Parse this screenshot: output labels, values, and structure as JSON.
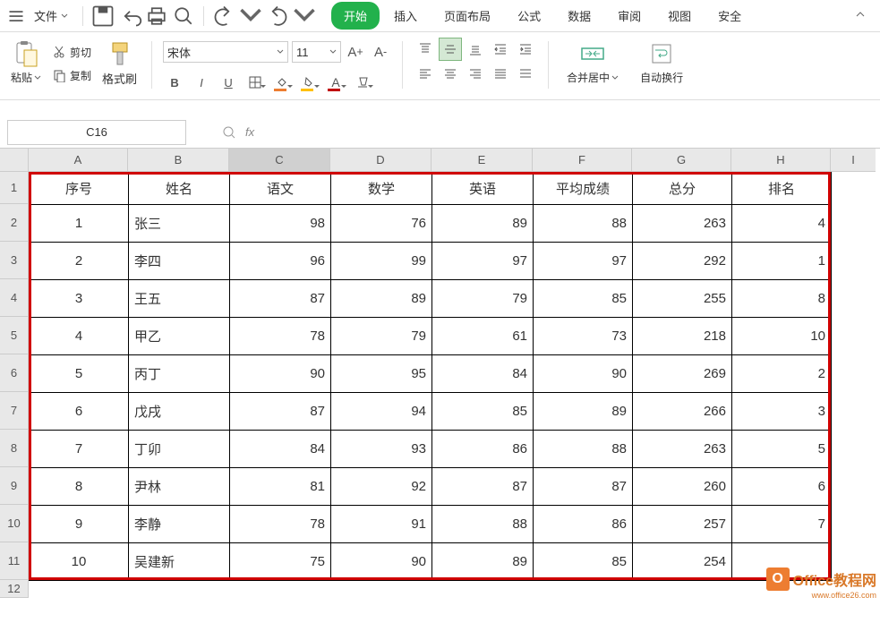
{
  "menu": {
    "file": "文件",
    "tabs": [
      "开始",
      "插入",
      "页面布局",
      "公式",
      "数据",
      "审阅",
      "视图",
      "安全"
    ],
    "active_tab": 0
  },
  "ribbon": {
    "paste": "粘贴",
    "cut": "剪切",
    "copy": "复制",
    "format_painter": "格式刷",
    "font_name": "宋体",
    "font_size": "11",
    "merge_center": "合并居中",
    "wrap_text": "自动换行"
  },
  "formula_bar": {
    "cell_ref": "C16",
    "fx": "fx"
  },
  "columns": [
    "A",
    "B",
    "C",
    "D",
    "E",
    "F",
    "G",
    "H",
    "I"
  ],
  "row_numbers": [
    "1",
    "2",
    "3",
    "4",
    "5",
    "6",
    "7",
    "8",
    "9",
    "10",
    "11",
    "12"
  ],
  "table": {
    "headers": [
      "序号",
      "姓名",
      "语文",
      "数学",
      "英语",
      "平均成绩",
      "总分",
      "排名"
    ],
    "rows": [
      {
        "seq": "1",
        "name": "张三",
        "chinese": "98",
        "math": "76",
        "english": "89",
        "avg": "88",
        "total": "263",
        "rank": "4"
      },
      {
        "seq": "2",
        "name": "李四",
        "chinese": "96",
        "math": "99",
        "english": "97",
        "avg": "97",
        "total": "292",
        "rank": "1"
      },
      {
        "seq": "3",
        "name": "王五",
        "chinese": "87",
        "math": "89",
        "english": "79",
        "avg": "85",
        "total": "255",
        "rank": "8"
      },
      {
        "seq": "4",
        "name": "甲乙",
        "chinese": "78",
        "math": "79",
        "english": "61",
        "avg": "73",
        "total": "218",
        "rank": "10"
      },
      {
        "seq": "5",
        "name": "丙丁",
        "chinese": "90",
        "math": "95",
        "english": "84",
        "avg": "90",
        "total": "269",
        "rank": "2"
      },
      {
        "seq": "6",
        "name": "戊戌",
        "chinese": "87",
        "math": "94",
        "english": "85",
        "avg": "89",
        "total": "266",
        "rank": "3"
      },
      {
        "seq": "7",
        "name": "丁卯",
        "chinese": "84",
        "math": "93",
        "english": "86",
        "avg": "88",
        "total": "263",
        "rank": "5"
      },
      {
        "seq": "8",
        "name": "尹林",
        "chinese": "81",
        "math": "92",
        "english": "87",
        "avg": "87",
        "total": "260",
        "rank": "6"
      },
      {
        "seq": "9",
        "name": "李静",
        "chinese": "78",
        "math": "91",
        "english": "88",
        "avg": "86",
        "total": "257",
        "rank": "7"
      },
      {
        "seq": "10",
        "name": "吴建新",
        "chinese": "75",
        "math": "90",
        "english": "89",
        "avg": "85",
        "total": "254",
        "rank": ""
      }
    ]
  },
  "watermark": {
    "text": "Office教程网",
    "url": "www.office26.com",
    "icon": "O"
  }
}
